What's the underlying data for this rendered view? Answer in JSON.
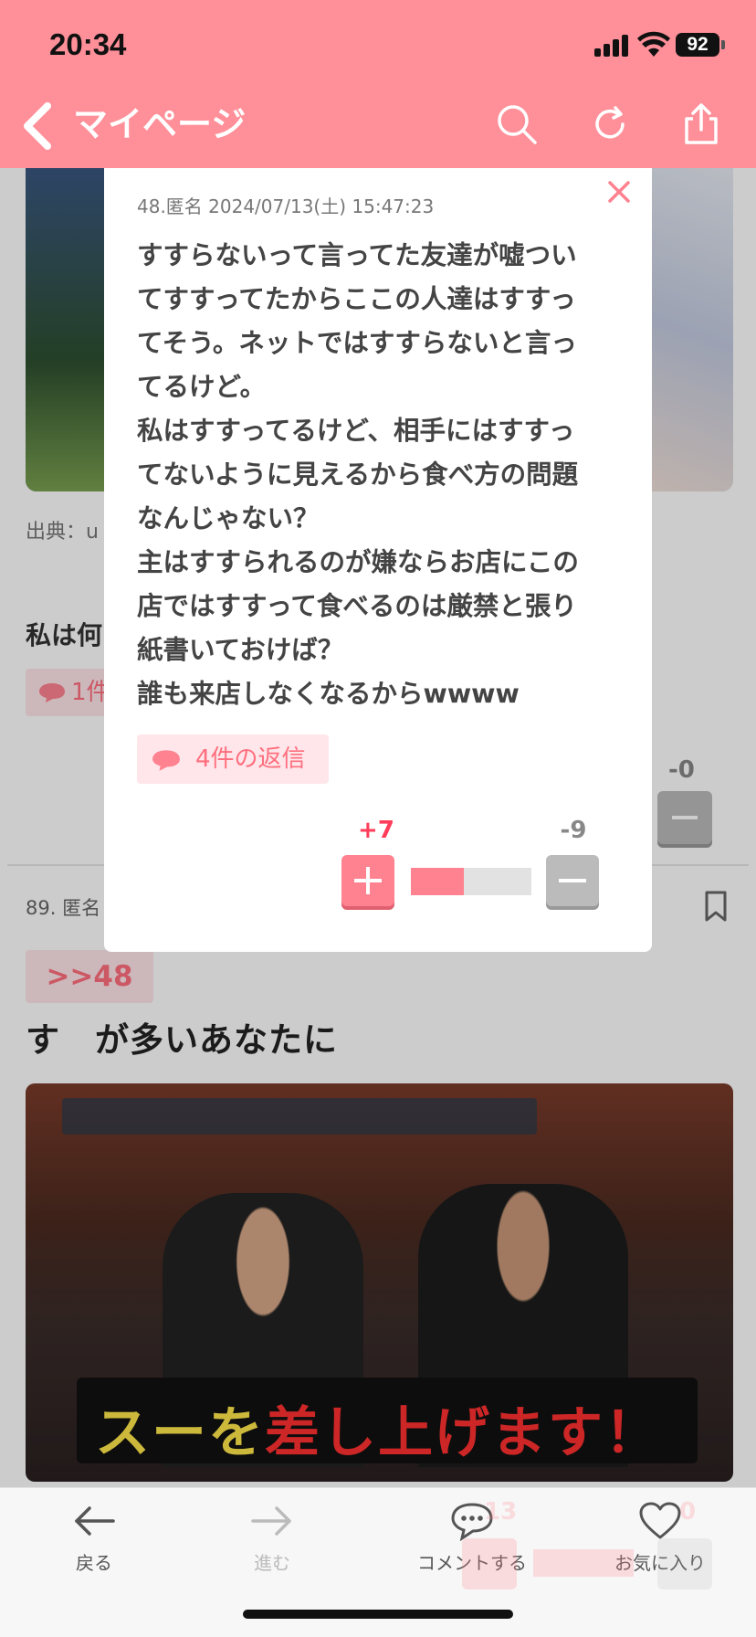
{
  "status_bar": {
    "time": "20:34",
    "battery": "92"
  },
  "nav": {
    "back_label": "マイページ"
  },
  "background": {
    "source_prefix": "出典：u",
    "comment_excerpt": "私は何",
    "reply_chip_excerpt": "1件",
    "minus_count": "-0",
    "post_meta": "89. 匿名",
    "anchor": ">>48",
    "post_title": "す　が多いあなたに",
    "image_caption_yellow": "スーを",
    "image_caption_red": "差し上げます！"
  },
  "popup": {
    "meta": "48.匿名 2024/07/13(土) 15:47:23",
    "body_lines": [
      "すすらないって言ってた友達が嘘つい",
      "てすすってたからここの人達はすすっ",
      "てそう。ネットではすすらないと言っ",
      "てるけど。",
      "私はすすってるけど、相手にはすすっ",
      "てないように見えるから食べ方の問題",
      "なんじゃない？",
      "主はすすられるのが嫌ならお店にこの",
      "店ではすすって食べるのは厳禁と張り",
      "紙書いておけば？",
      "誰も来店しなくなるからwwww"
    ],
    "replies_label": "4件の返信",
    "plus_count": "+7",
    "minus_count": "-9",
    "plus_ratio": 0.4375
  },
  "toolbar": {
    "back_label": "戻る",
    "forward_label": "進む",
    "comment_label": "コメントする",
    "favorite_label": "お気に入り"
  },
  "ghost": {
    "plus_count": "13",
    "minus_count": "0"
  },
  "colors": {
    "accent": "#ff8f99",
    "plus": "#ff8290",
    "link": "#ff6f7e"
  }
}
